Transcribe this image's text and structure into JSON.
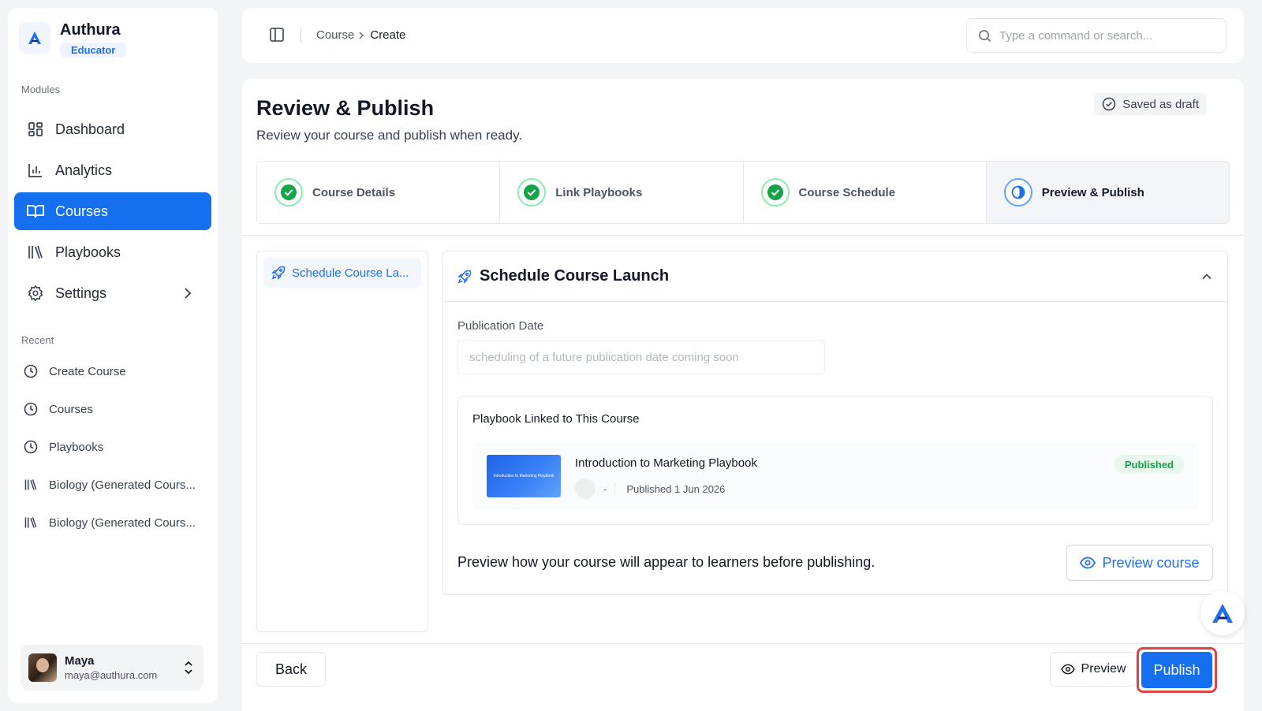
{
  "brand": {
    "name": "Authura",
    "role": "Educator"
  },
  "sidebar": {
    "modules_label": "Modules",
    "items": [
      {
        "label": "Dashboard",
        "icon": "dashboard-icon"
      },
      {
        "label": "Analytics",
        "icon": "bar-chart-icon"
      },
      {
        "label": "Courses",
        "icon": "book-open-icon",
        "active": true
      },
      {
        "label": "Playbooks",
        "icon": "library-icon"
      },
      {
        "label": "Settings",
        "icon": "gear-icon"
      }
    ],
    "recent_label": "Recent",
    "recent": [
      {
        "label": "Create Course",
        "icon": "clock-icon"
      },
      {
        "label": "Courses",
        "icon": "clock-icon"
      },
      {
        "label": "Playbooks",
        "icon": "clock-icon"
      },
      {
        "label": "Biology (Generated Cours...",
        "icon": "library-icon"
      },
      {
        "label": "Biology (Generated Cours...",
        "icon": "library-icon"
      }
    ],
    "user": {
      "name": "Maya",
      "email": "maya@authura.com"
    }
  },
  "topbar": {
    "breadcrumb": [
      "Course",
      "Create"
    ],
    "search_placeholder": "Type a command or search..."
  },
  "page": {
    "title": "Review & Publish",
    "subtitle": "Review your course and publish when ready.",
    "saved_status": "Saved as draft"
  },
  "steps": [
    {
      "label": "Course Details",
      "state": "done"
    },
    {
      "label": "Link Playbooks",
      "state": "done"
    },
    {
      "label": "Course Schedule",
      "state": "done"
    },
    {
      "label": "Preview & Publish",
      "state": "current"
    }
  ],
  "side_list": {
    "item": "Schedule Course La..."
  },
  "launch": {
    "title": "Schedule Course Launch",
    "publication_label": "Publication Date",
    "publication_placeholder": "scheduling of a future publication date coming soon",
    "linked_title": "Playbook Linked to This Course",
    "playbook": {
      "thumb_text": "Introduction to Marketing Playbook",
      "title": "Introduction to Marketing Playbook",
      "author_dash": "-",
      "published_date": "Published 1 Jun 2026",
      "status": "Published"
    },
    "preview_text": "Preview how your course will appear to learners before publishing.",
    "preview_course_label": "Preview course"
  },
  "footer": {
    "back_label": "Back",
    "preview_label": "Preview",
    "publish_label": "Publish"
  },
  "colors": {
    "accent": "#1570ef",
    "success": "#16a34a",
    "highlight_border": "#e04444"
  }
}
